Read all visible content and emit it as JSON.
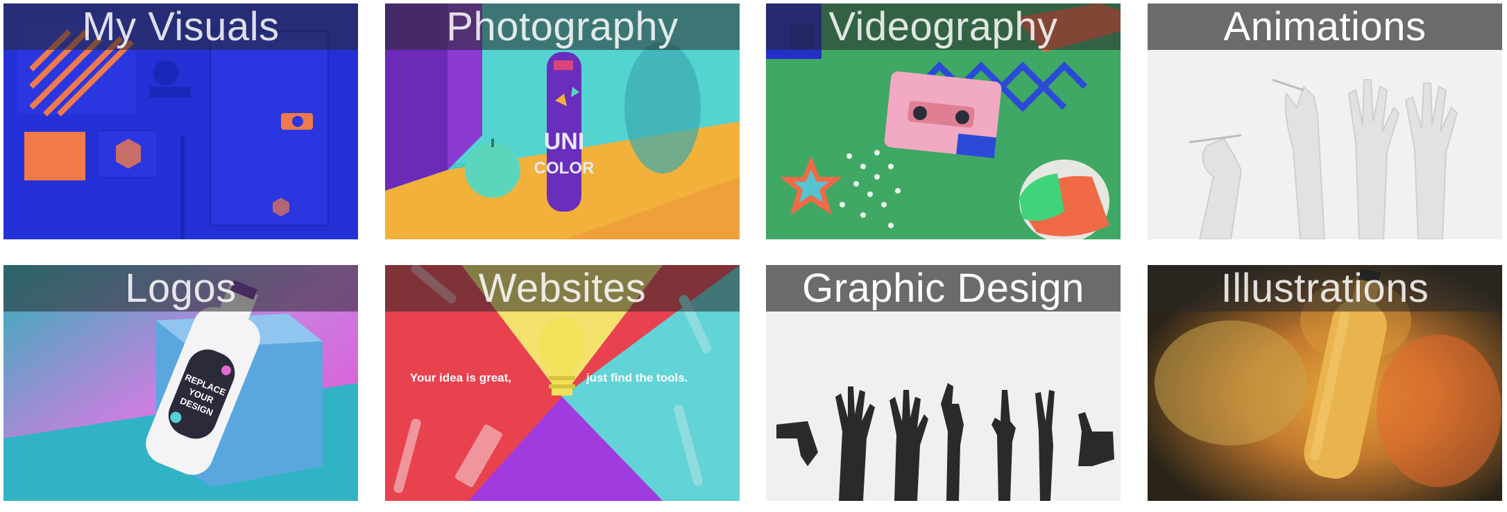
{
  "gallery": {
    "tiles": [
      {
        "title": "My Visuals",
        "art": "blue-stationery-mockup"
      },
      {
        "title": "Photography",
        "art": "unicolor-bottle-apple"
      },
      {
        "title": "Videography",
        "art": "cassette-bow-apple"
      },
      {
        "title": "Animations",
        "art": "white-hands"
      },
      {
        "title": "Logos",
        "art": "replace-your-design-bottle"
      },
      {
        "title": "Websites",
        "art": "lightbulb-tools",
        "text_left": "Your idea is great,",
        "text_right": "just find the tools."
      },
      {
        "title": "Graphic Design",
        "art": "black-hand-gestures"
      },
      {
        "title": "Illustrations",
        "art": "yellow-bottle-powder"
      }
    ]
  },
  "colors": {
    "caption_overlay": "#282828",
    "caption_grey": "#6b6b6b",
    "caption_text": "#ffffff"
  }
}
